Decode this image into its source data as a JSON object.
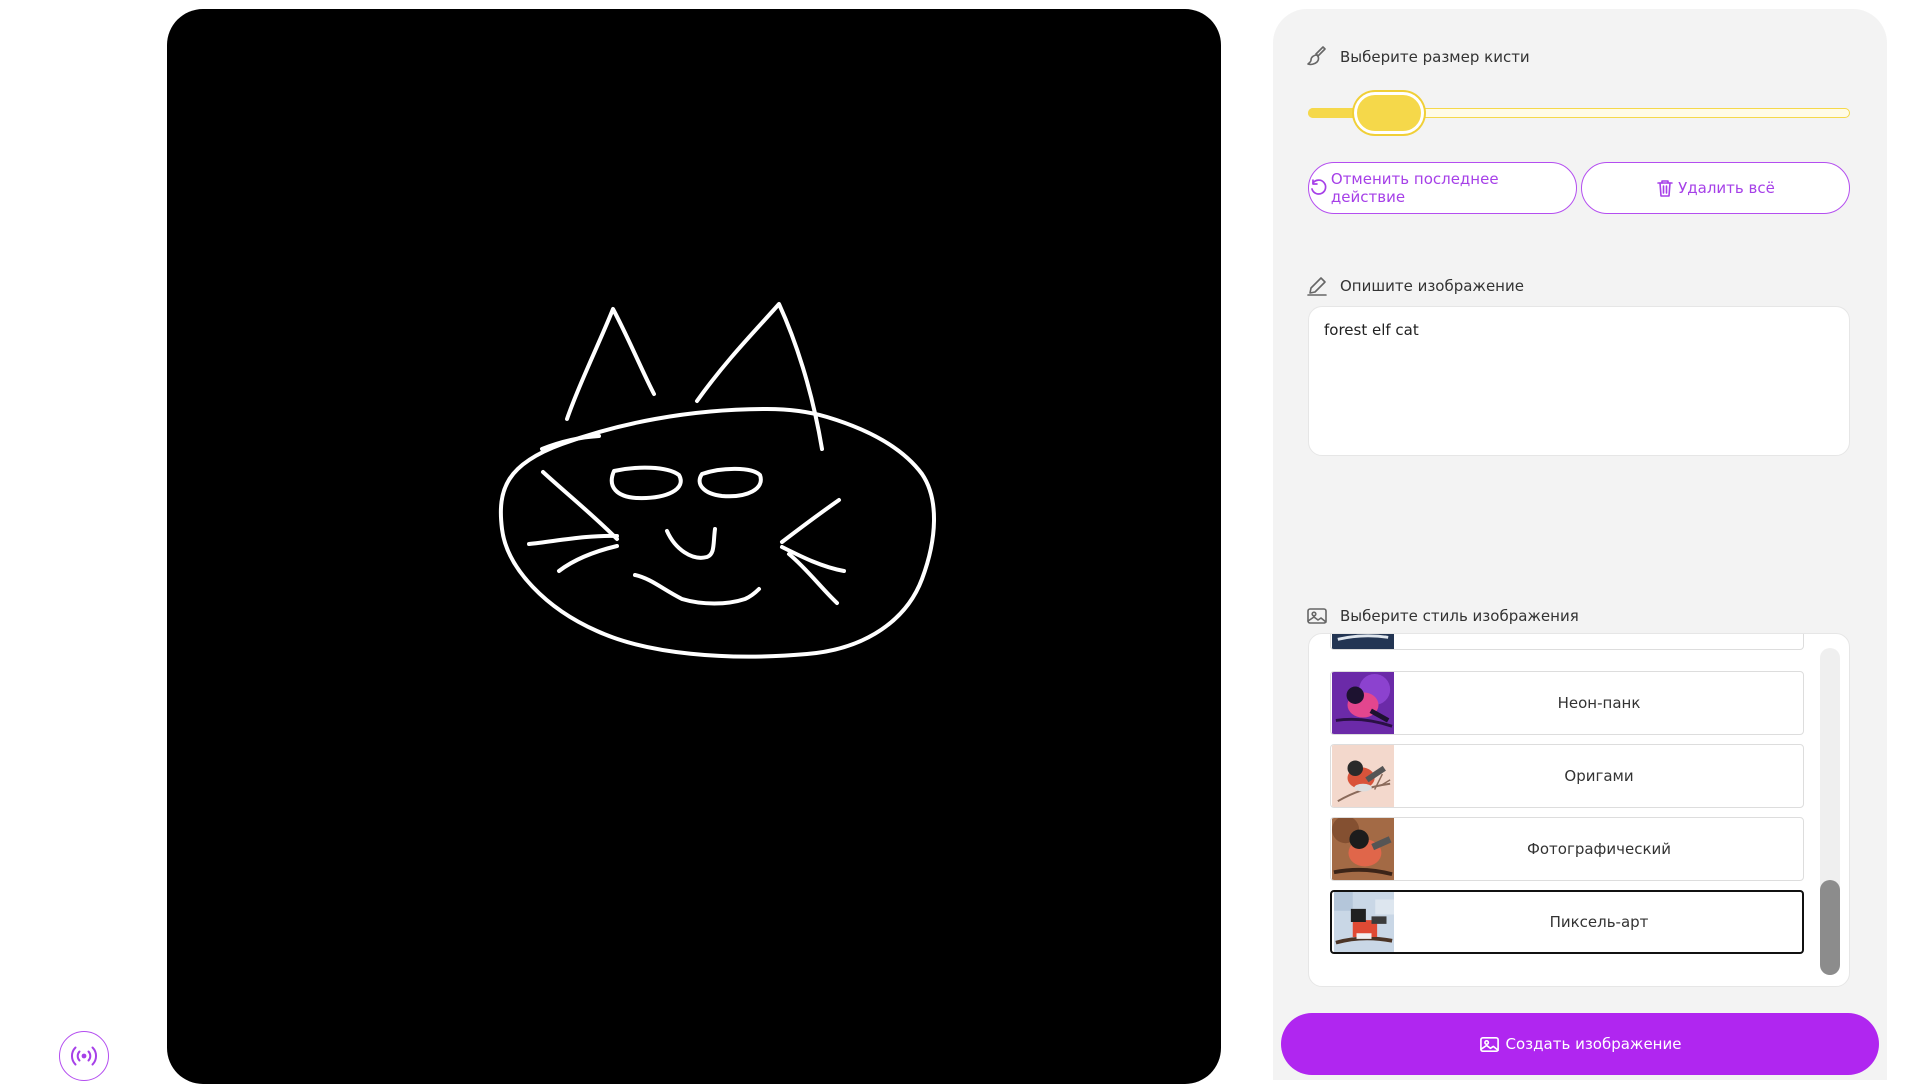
{
  "brush": {
    "label": "Выберите размер кисти",
    "size_fraction": 0.15
  },
  "actions": {
    "undo_label": "Отменить последнее действие",
    "clear_label": "Удалить всё"
  },
  "prompt": {
    "label": "Опишите изображение",
    "value": "forest elf cat"
  },
  "style": {
    "label": "Выберите стиль изображения",
    "items": [
      {
        "name": "",
        "icon": "bullfinch-thumbnail",
        "visible": "partial"
      },
      {
        "name": "Неон-панк",
        "icon": "bullfinch-thumbnail"
      },
      {
        "name": "Оригами",
        "icon": "bullfinch-thumbnail"
      },
      {
        "name": "Фотографический",
        "icon": "bullfinch-thumbnail"
      },
      {
        "name": "Пиксель-арт",
        "icon": "bullfinch-thumbnail",
        "selected": true
      }
    ]
  },
  "create_button": {
    "label": "Создать изображение"
  },
  "colors": {
    "accent": "#b026f0",
    "outline": "#b44ef0",
    "slider": "#f5d84a",
    "canvas": "#000000",
    "stroke": "#ffffff"
  },
  "icons": {
    "broadcast": "broadcast-icon",
    "brush": "brush-icon",
    "undo": "undo-icon",
    "trash": "trash-icon",
    "pencil": "pencil-icon",
    "image": "image-icon"
  }
}
